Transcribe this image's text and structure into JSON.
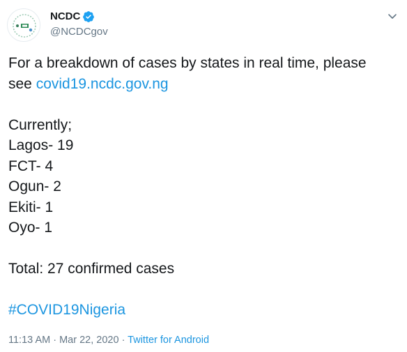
{
  "author": {
    "display_name": "NCDC",
    "handle": "@NCDCgov"
  },
  "tweet": {
    "intro_line1": "For a breakdown of cases by states in real time, please",
    "intro_line2_prefix": "see ",
    "link_text": "covid19.ncdc.gov.ng",
    "currently_label": "Currently;",
    "states": [
      {
        "text": "Lagos- 19"
      },
      {
        "text": "FCT- 4"
      },
      {
        "text": "Ogun- 2"
      },
      {
        "text": "Ekiti- 1"
      },
      {
        "text": "Oyo- 1"
      }
    ],
    "total": "Total: 27 confirmed cases",
    "hashtag": "#COVID19Nigeria"
  },
  "meta": {
    "time": "11:13 AM",
    "separator": " · ",
    "date": "Mar 22, 2020",
    "separator2": " · ",
    "source": "Twitter for Android"
  },
  "colors": {
    "link": "#1b95e0",
    "verified": "#1da1f2",
    "muted": "#657786",
    "text": "#14171a"
  },
  "icons": [
    "verified-badge-icon",
    "chevron-down-icon",
    "ncdc-logo-avatar"
  ]
}
